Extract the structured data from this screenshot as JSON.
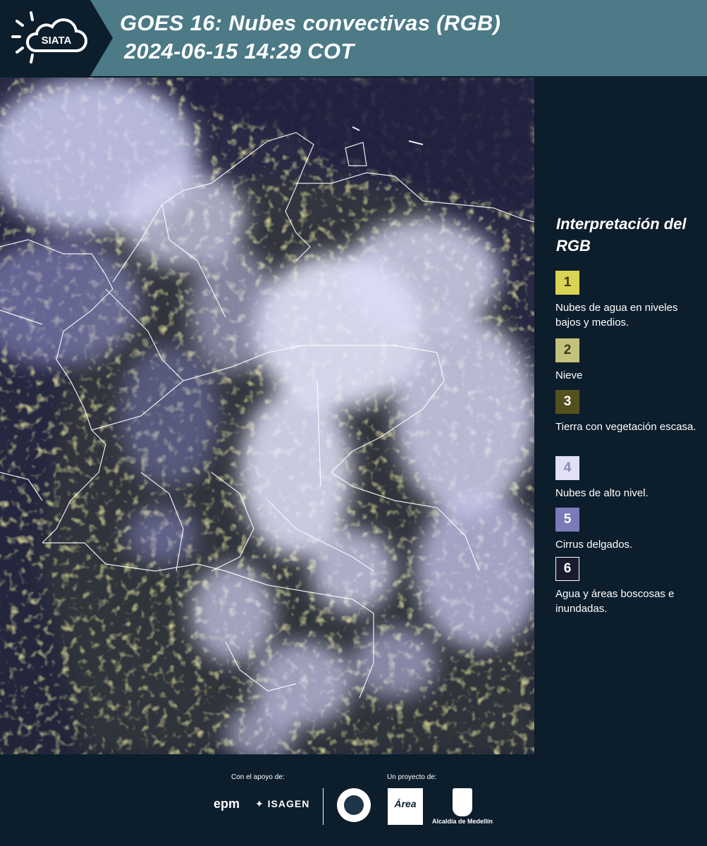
{
  "header": {
    "logo_text": "SIATA",
    "title_line1": "GOES 16: Nubes convectivas (RGB)",
    "title_line2": "2024-06-15 14:29 COT"
  },
  "legend": {
    "title": "Interpretación del RGB",
    "items": [
      {
        "number": "1",
        "label": "Nubes de agua en niveles bajos y medios.",
        "color": "#dad454",
        "text_color": "#3a3a10"
      },
      {
        "number": "2",
        "label": "Nieve",
        "color": "#c3c27d",
        "text_color": "#3a3a10"
      },
      {
        "number": "3",
        "label": "Tierra con vegetación escasa.",
        "color": "#55511f",
        "text_color": "#ffffff"
      },
      {
        "number": "4",
        "label": "Nubes de alto nivel.",
        "color": "#e1e0f6",
        "text_color": "#8a8ab0"
      },
      {
        "number": "5",
        "label": "Cirrus delgados.",
        "color": "#7b7bb8",
        "text_color": "#ffffff"
      },
      {
        "number": "6",
        "label": "Agua y áreas boscosas e inundadas.",
        "color": "#1b1b2e",
        "text_color": "#ffffff"
      }
    ]
  },
  "footer": {
    "support_label": "Con el apoyo de:",
    "project_label": "Un proyecto de:",
    "sponsor_epm": "epm",
    "sponsor_isagen": "ISAGEN",
    "partner_area": "Área",
    "partner_alcaldia": "Alcaldía de Medellín"
  },
  "colors": {
    "header_bg": "#4c7a86",
    "panel_bg": "#0c1d2b",
    "cloud_high": "#e4e4fb",
    "cloud_cirrus": "#8e8ed8",
    "cloud_low": "#d8d45a",
    "surface_dark": "#25263f"
  }
}
